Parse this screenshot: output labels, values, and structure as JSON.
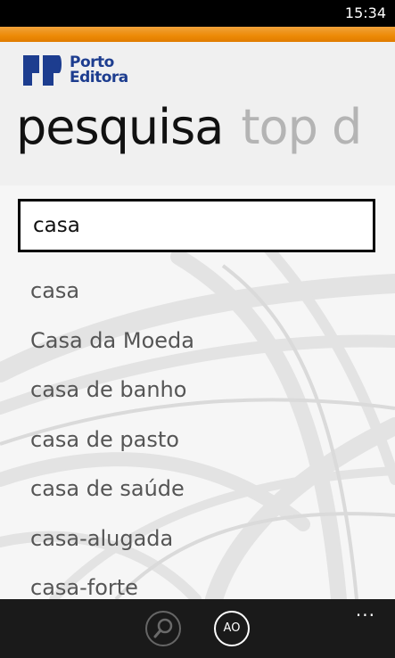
{
  "status_bar": {
    "time": "15:34"
  },
  "brand": {
    "line1": "Porto",
    "line2": "Editora",
    "color": "#1d3d8f",
    "accent": "#ed8a06"
  },
  "pivot": {
    "active": "pesquisa",
    "next": "top d"
  },
  "search": {
    "value": "casa",
    "placeholder": ""
  },
  "suggestions": [
    "casa",
    "Casa da Moeda",
    "casa de banho",
    "casa de pasto",
    "casa de saúde",
    "casa-alugada",
    "casa-forte"
  ],
  "app_bar": {
    "search_icon": "magnifier-icon",
    "ao_label": "AO",
    "more_label": "..."
  }
}
